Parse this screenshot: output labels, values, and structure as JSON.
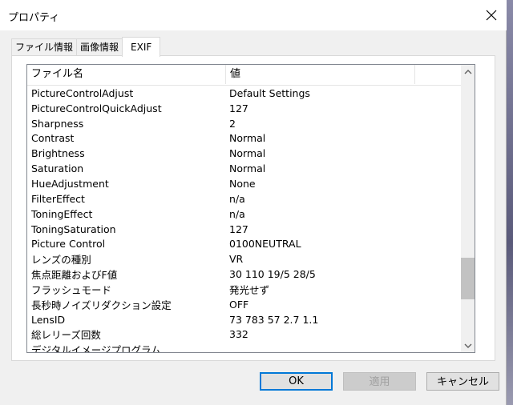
{
  "window": {
    "title": "プロパティ"
  },
  "tabs": [
    {
      "label": "ファイル情報"
    },
    {
      "label": "画像情報"
    },
    {
      "label": "EXIF"
    }
  ],
  "list": {
    "headers": {
      "name": "ファイル名",
      "value": "値"
    },
    "rows": [
      {
        "name": "PictureControlAdjust",
        "value": "Default Settings"
      },
      {
        "name": "PictureControlQuickAdjust",
        "value": "127"
      },
      {
        "name": "Sharpness",
        "value": "2"
      },
      {
        "name": "Contrast",
        "value": "Normal"
      },
      {
        "name": "Brightness",
        "value": "Normal"
      },
      {
        "name": "Saturation",
        "value": "Normal"
      },
      {
        "name": "HueAdjustment",
        "value": "None"
      },
      {
        "name": "FilterEffect",
        "value": "n/a"
      },
      {
        "name": "ToningEffect",
        "value": "n/a"
      },
      {
        "name": "ToningSaturation",
        "value": "127"
      },
      {
        "name": "Picture Control",
        "value": "0100NEUTRAL"
      },
      {
        "name": "レンズの種別",
        "value": "VR"
      },
      {
        "name": "焦点距離およびF値",
        "value": "30 110 19/5 28/5"
      },
      {
        "name": "フラッシュモード",
        "value": "発光せず"
      },
      {
        "name": "長秒時ノイズリダクション設定",
        "value": "OFF"
      },
      {
        "name": "LensID",
        "value": "73 783 57 2.7 1.1"
      },
      {
        "name": "総レリーズ回数",
        "value": "332"
      },
      {
        "name": "デジタルイメージプログラム",
        "value": ""
      }
    ],
    "scroll_position": 0.82
  },
  "buttons": {
    "ok": "OK",
    "apply": "適用",
    "cancel": "キャンセル"
  }
}
